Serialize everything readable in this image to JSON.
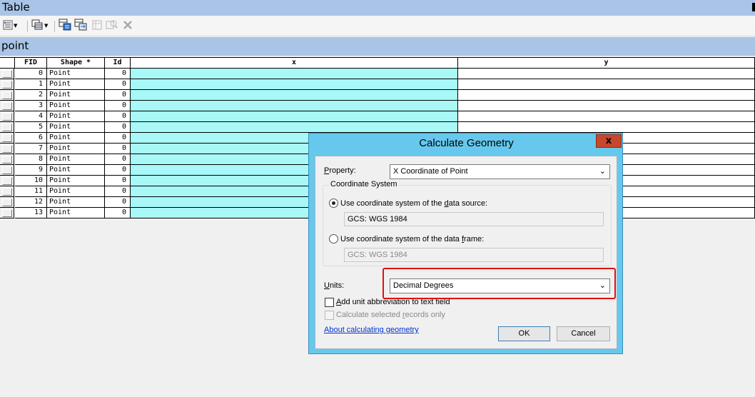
{
  "window": {
    "title": "Table"
  },
  "toolbar": {
    "icons": [
      "table-options-icon",
      "related-tables-icon",
      "select-by-attributes-icon",
      "switch-selection-icon",
      "clear-selection-icon",
      "zoom-to-selected-icon",
      "delete-selected-icon"
    ]
  },
  "table": {
    "name": "point",
    "columns": [
      "FID",
      "Shape *",
      "Id",
      "x",
      "y"
    ],
    "rows": [
      {
        "fid": "0",
        "shape": "Point",
        "id": "0"
      },
      {
        "fid": "1",
        "shape": "Point",
        "id": "0"
      },
      {
        "fid": "2",
        "shape": "Point",
        "id": "0"
      },
      {
        "fid": "3",
        "shape": "Point",
        "id": "0"
      },
      {
        "fid": "4",
        "shape": "Point",
        "id": "0"
      },
      {
        "fid": "5",
        "shape": "Point",
        "id": "0"
      },
      {
        "fid": "6",
        "shape": "Point",
        "id": "0"
      },
      {
        "fid": "7",
        "shape": "Point",
        "id": "0"
      },
      {
        "fid": "8",
        "shape": "Point",
        "id": "0"
      },
      {
        "fid": "9",
        "shape": "Point",
        "id": "0"
      },
      {
        "fid": "10",
        "shape": "Point",
        "id": "0"
      },
      {
        "fid": "11",
        "shape": "Point",
        "id": "0"
      },
      {
        "fid": "12",
        "shape": "Point",
        "id": "0"
      },
      {
        "fid": "13",
        "shape": "Point",
        "id": "0"
      }
    ],
    "selected_column_color": "#a8f8f8"
  },
  "dialog": {
    "title": "Calculate Geometry",
    "close_label": "x",
    "property_label_pre": "",
    "property_label_key": "P",
    "property_label_post": "roperty:",
    "property_value": "X Coordinate of Point",
    "coord_system_legend": "Coordinate System",
    "radio_source_pre": "Use coordinate system of the ",
    "radio_source_key": "d",
    "radio_source_post": "ata source:",
    "source_value": "GCS: WGS 1984",
    "radio_frame_pre": "Use coordinate system of the data ",
    "radio_frame_key": "f",
    "radio_frame_post": "rame:",
    "frame_value": "GCS: WGS 1984",
    "units_label_pre": "",
    "units_label_key": "U",
    "units_label_post": "nits:",
    "units_value": "Decimal Degrees",
    "add_abbrev_pre": "",
    "add_abbrev_key": "A",
    "add_abbrev_post": "dd unit abbreviation to text field",
    "calc_selected_pre": "Calculate selected ",
    "calc_selected_key": "r",
    "calc_selected_post": "ecords only",
    "help_link": "About calculating geometry",
    "ok_label": "OK",
    "cancel_label": "Cancel",
    "highlight_color": "#e01010"
  }
}
